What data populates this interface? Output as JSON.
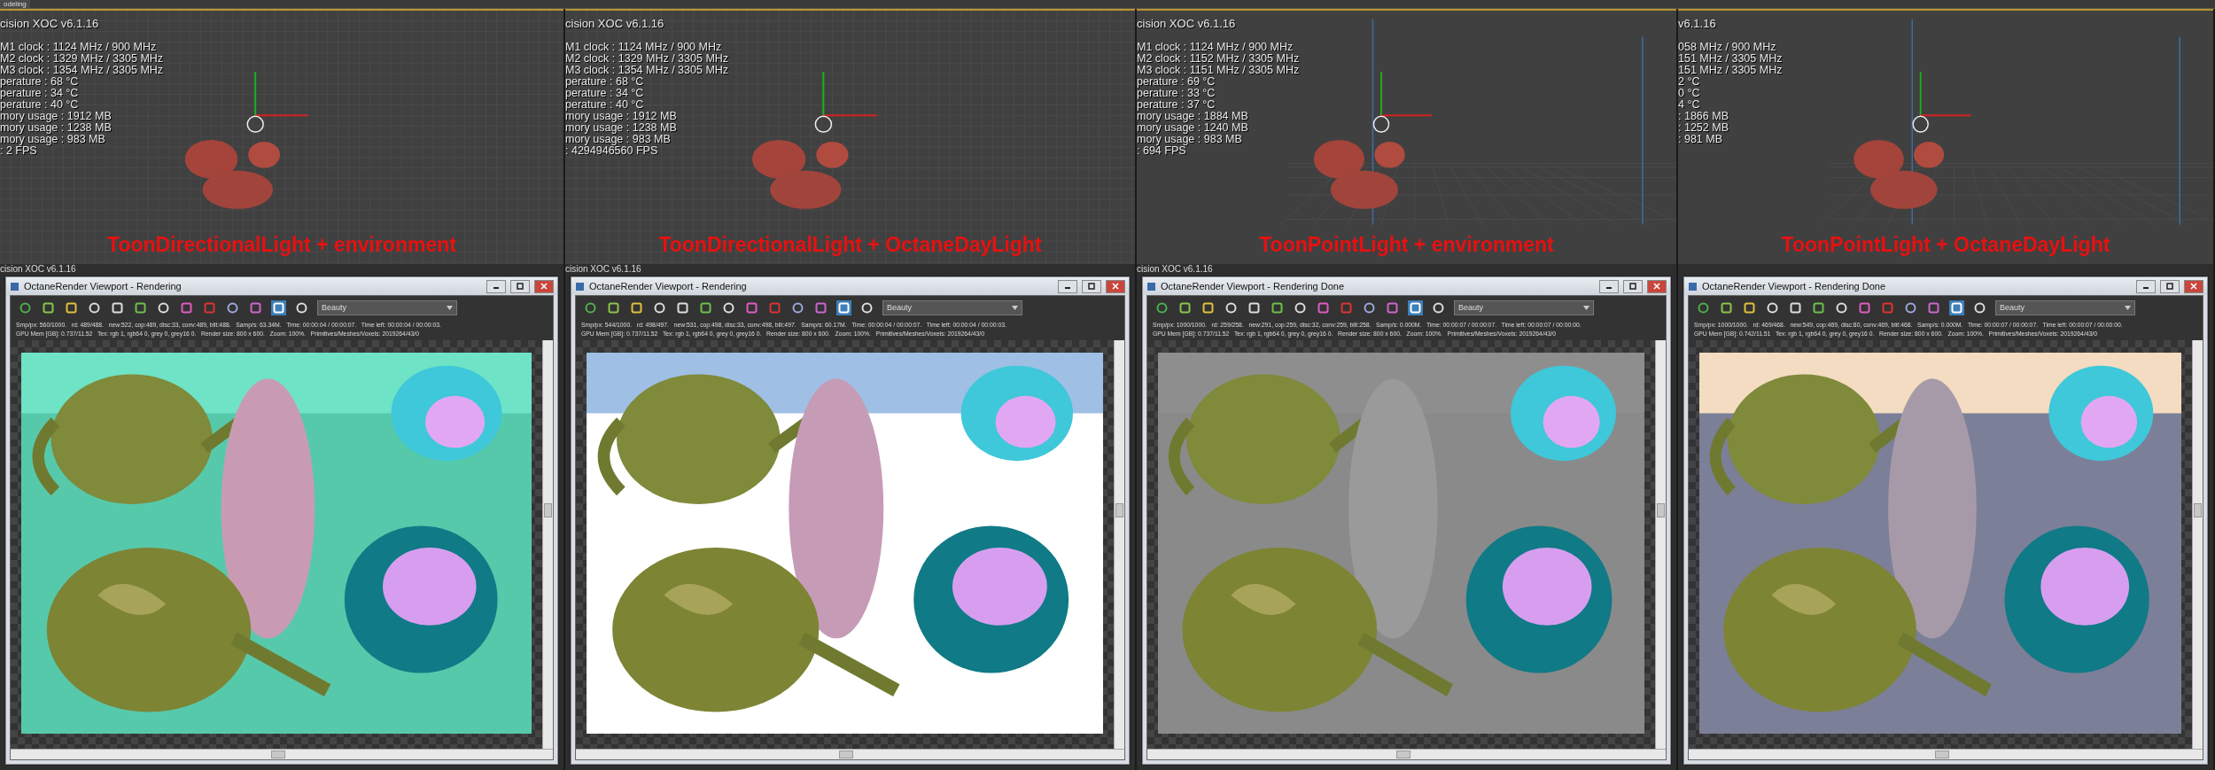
{
  "mode_tab": "odeling",
  "panels": [
    {
      "viewport": {
        "kind": "top",
        "osd_title": "cision XOC  v6.1.16",
        "osd_lines": [
          "M1 clock : 1124 MHz / 900 MHz",
          "M2 clock : 1329 MHz / 3305 MHz",
          "M3 clock : 1354 MHz / 3305 MHz",
          "perature : 68 °C",
          "perature : 34 °C",
          "perature : 40 °C",
          "mory usage : 1912 MB",
          "mory usage : 1238 MB",
          "mory usage : 983 MB",
          ": 2 FPS"
        ],
        "caption": "ToonDirectionalLight + environment"
      },
      "render_window": {
        "peek_label": "cision XOC  v6.1.16",
        "title": "OctaneRender Viewport - Rendering",
        "pass": "Beauty",
        "stats": [
          "Smp/px: 560/1000.   rd: 489/488.   new:522, cop:489, disc:33, conv:489, blit:488.   Samp/s: 63.34M.   Time: 00:00:04 / 00:00:07.   Time left: 00:00:04 / 00:00:03.",
          "GPU Mem [GB]: 0.737/11.52   Tex: rgb 1, rgb64 0, grey 0, grey16 0.   Render size: 800 x 600.   Zoom: 100%.   Primitives/Meshes/Voxels: 2019264/43/0"
        ]
      }
    },
    {
      "viewport": {
        "kind": "top",
        "osd_title": "cision XOC  v6.1.16",
        "osd_lines": [
          "M1 clock : 1124 MHz / 900 MHz",
          "M2 clock : 1329 MHz / 3305 MHz",
          "M3 clock : 1354 MHz / 3305 MHz",
          "perature : 68 °C",
          "perature : 34 °C",
          "perature : 40 °C",
          "mory usage : 1912 MB",
          "mory usage : 1238 MB",
          "mory usage : 983 MB",
          ": 4294946560 FPS"
        ],
        "caption": "ToonDirectionalLight + OctaneDayLight"
      },
      "render_window": {
        "peek_label": "cision XOC  v6.1.16",
        "title": "OctaneRender Viewport - Rendering",
        "pass": "Beauty",
        "stats": [
          "Smp/px: 544/1000.   rd: 498/497.   new:531, cop:498, disc:33, conv:498, blit:497.   Samp/s: 60.17M.   Time: 00:00:04 / 00:00:07.   Time left: 00:00:04 / 00:00:03.",
          "GPU Mem [GB]: 0.737/11.52   Tex: rgb 1, rgb64 0, grey 0, grey16 0.   Render size: 800 x 600.   Zoom: 100%.   Primitives/Meshes/Voxels: 2019264/43/0"
        ]
      }
    },
    {
      "viewport": {
        "kind": "perspective",
        "osd_title": "cision XOC  v6.1.16",
        "osd_lines": [
          "M1 clock : 1124 MHz / 900 MHz",
          "M2 clock : 1152 MHz / 3305 MHz",
          "M3 clock : 1151 MHz / 3305 MHz",
          "perature : 69 °C",
          "perature : 33 °C",
          "perature : 37 °C",
          "mory usage : 1884 MB",
          "mory usage : 1240 MB",
          "mory usage : 983 MB",
          ": 694 FPS"
        ],
        "caption": "ToonPointLight + environment"
      },
      "render_window": {
        "peek_label": "cision XOC  v6.1.16",
        "title": "OctaneRender Viewport - Rendering Done",
        "pass": "Beauty",
        "stats": [
          "Smp/px: 1000/1000.   rd: 259/258.   new:291, cop:259, disc:32, conv:259, blit:258.   Samp/s: 0.000M.   Time: 00:00:07 / 00:00:07.   Time left: 00:00:07 / 00:00:00.",
          "GPU Mem [GB]: 0.737/11.52   Tex: rgb 1, rgb64 0, grey 0, grey16 0.   Render size: 800 x 600.   Zoom: 100%.   Primitives/Meshes/Voxels: 2019264/43/0"
        ]
      }
    },
    {
      "viewport": {
        "kind": "perspective",
        "osd_title": "v6.1.16",
        "osd_lines": [
          "058 MHz / 900 MHz",
          "151 MHz / 3305 MHz",
          "151 MHz / 3305 MHz",
          "2 °C",
          "0 °C",
          "4 °C",
          ": 1866 MB",
          ": 1252 MB",
          ": 981 MB"
        ],
        "caption": "ToonPointLight + OctaneDayLight"
      },
      "render_window": {
        "title": "OctaneRender Viewport - Rendering Done",
        "pass": "Beauty",
        "stats": [
          "Smp/px: 1000/1000.   rd: 469/468.   new:549, cop:469, disc:80, conv:469, blit:468.   Samp/s: 0.000M.   Time: 00:00:07 / 00:00:07.   Time left: 00:00:07 / 00:00:00.",
          "GPU Mem [GB]: 0.742/11.51   Tex: rgb 1, rgb64 0, grey 0, grey16 0.   Render size: 800 x 600.   Zoom: 100%.   Primitives/Meshes/Voxels: 2019264/43/0"
        ]
      }
    }
  ]
}
